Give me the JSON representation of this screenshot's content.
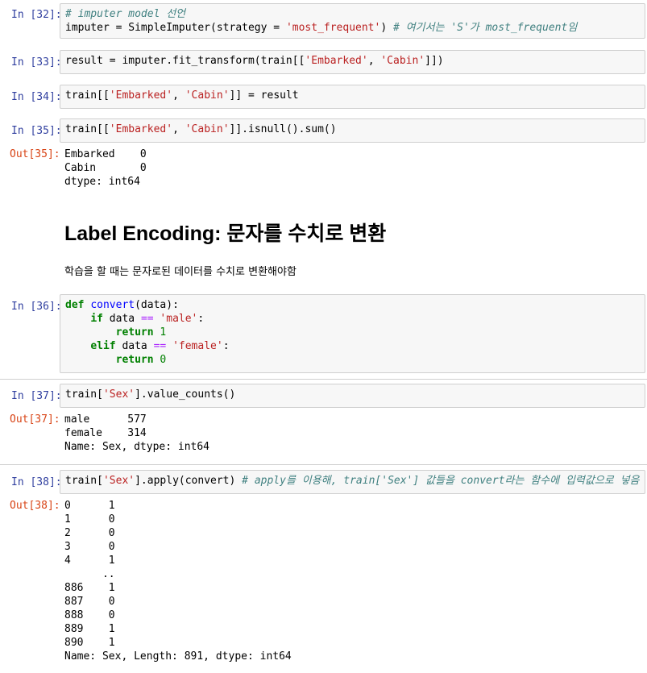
{
  "cells": {
    "c32": {
      "prompt": "In [32]:",
      "line1": "# imputer model 선언",
      "line2_a": "imputer = SimpleImputer(strategy = ",
      "line2_str": "'most_frequent'",
      "line2_b": ") ",
      "line2_cm": "# 여기서는 'S'가 most_frequent임"
    },
    "c33": {
      "prompt": "In [33]:",
      "a": "result = imputer.fit_transform(train[[",
      "s1": "'Embarked'",
      "b": ", ",
      "s2": "'Cabin'",
      "c": "]])"
    },
    "c34": {
      "prompt": "In [34]:",
      "a": "train[[",
      "s1": "'Embarked'",
      "b": ", ",
      "s2": "'Cabin'",
      "c": "]] = result"
    },
    "c35": {
      "prompt": "In [35]:",
      "a": "train[[",
      "s1": "'Embarked'",
      "b": ", ",
      "s2": "'Cabin'",
      "c": "]].isnull().sum()",
      "out_prompt": "Out[35]:",
      "output": "Embarked    0\nCabin       0\ndtype: int64"
    },
    "markdown": {
      "heading": "Label Encoding: 문자를 수치로 변환",
      "paragraph": "학습을 할 때는 문자로된 데이터를 수치로 변환해야함"
    },
    "c36": {
      "prompt": "In [36]:",
      "kw_def": "def",
      "fn_name": "convert",
      "def_rest": "(data):",
      "kw_if": "if",
      "if_mid": " data ",
      "op_eq": "==",
      "str_male": "'male'",
      "colon": ":",
      "kw_return": "return",
      "num_1": "1",
      "kw_elif": "elif",
      "str_female": "'female'",
      "num_0": "0"
    },
    "c37": {
      "prompt": "In [37]:",
      "a": "train[",
      "s": "'Sex'",
      "b": "].value_counts()",
      "out_prompt": "Out[37]:",
      "output": "male      577\nfemale    314\nName: Sex, dtype: int64"
    },
    "c38": {
      "prompt": "In [38]:",
      "a": "train[",
      "s": "'Sex'",
      "b": "].apply(convert) ",
      "cm": "# apply를 이용해, train['Sex'] 값들을 convert라는 함수에 입력값으로 넣음",
      "out_prompt": "Out[38]:",
      "output": "0      1\n1      0\n2      0\n3      0\n4      1\n      ..\n886    1\n887    0\n888    0\n889    1\n890    1\nName: Sex, Length: 891, dtype: int64"
    }
  }
}
